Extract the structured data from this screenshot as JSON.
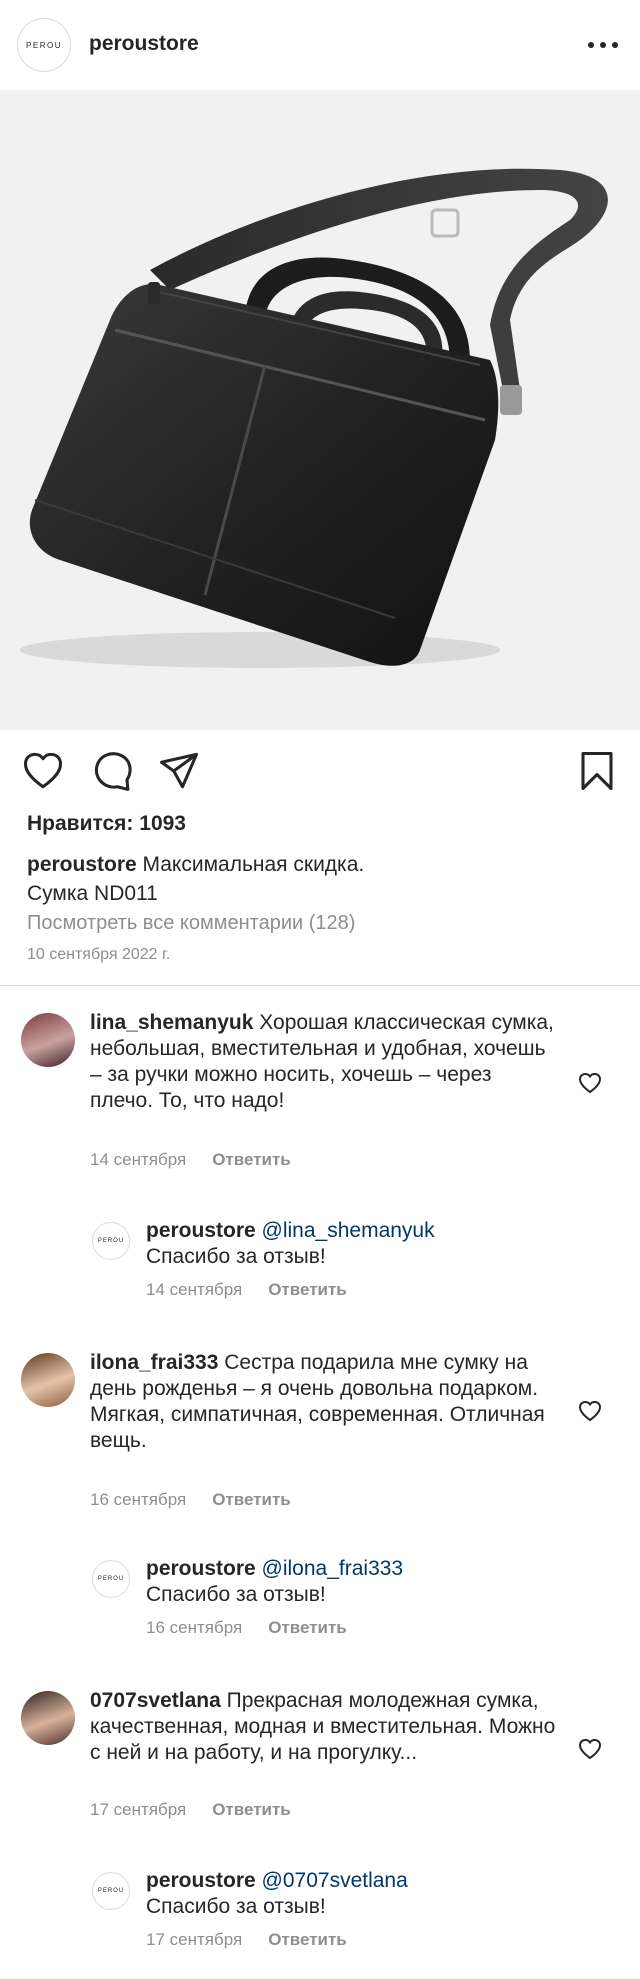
{
  "header": {
    "avatar_text": "PEROU",
    "username": "peroustore"
  },
  "post": {
    "likes": "Нравится: 1093",
    "caption_user": "peroustore",
    "caption_line1": " Максимальная скидка.",
    "caption_line2": "Сумка ND011",
    "view_all": "Посмотреть все комментарии (128)",
    "date": "10 сентября 2022 г."
  },
  "comments": [
    {
      "user": "lina_shemanyuk",
      "text": " Хорошая классическая сумка, небольшая, вместительная и удобная, хочешь – за ручки можно носить, хочешь – через плечо. То, что надо!",
      "date": "14 сентября",
      "reply": "Ответить",
      "answer": {
        "user": "peroustore",
        "mention": "@lina_shemanyuk",
        "text": "Спасибо за отзыв!",
        "date": "14 сентября",
        "reply": "Ответить",
        "avatar_text": "PEROU"
      }
    },
    {
      "user": "ilona_frai333",
      "text": " Сестра подарила мне сумку на день рожденья – я очень довольна подарком. Мягкая, симпатичная, современная. Отличная вещь.",
      "date": "16 сентября",
      "reply": "Ответить",
      "answer": {
        "user": "peroustore",
        "mention": "@ilona_frai333",
        "text": "Спасибо за отзыв!",
        "date": "16 сентября",
        "reply": "Ответить",
        "avatar_text": "PEROU"
      }
    },
    {
      "user": "0707svetlana",
      "text": " Прекрасная молодежная сумка, качественная, модная и вместительная. Можно с ней и на работу, и на прогулку...",
      "date": "17 сентября",
      "reply": "Ответить",
      "answer": {
        "user": "peroustore",
        "mention": "@0707svetlana",
        "text": "Спасибо за отзыв!",
        "date": "17 сентября",
        "reply": "Ответить",
        "avatar_text": "PEROU"
      }
    }
  ],
  "colors": {
    "text": "#262626",
    "secondary": "#8e8e8e",
    "mention": "#00376b",
    "photo_bg": "#f1f1f1"
  }
}
